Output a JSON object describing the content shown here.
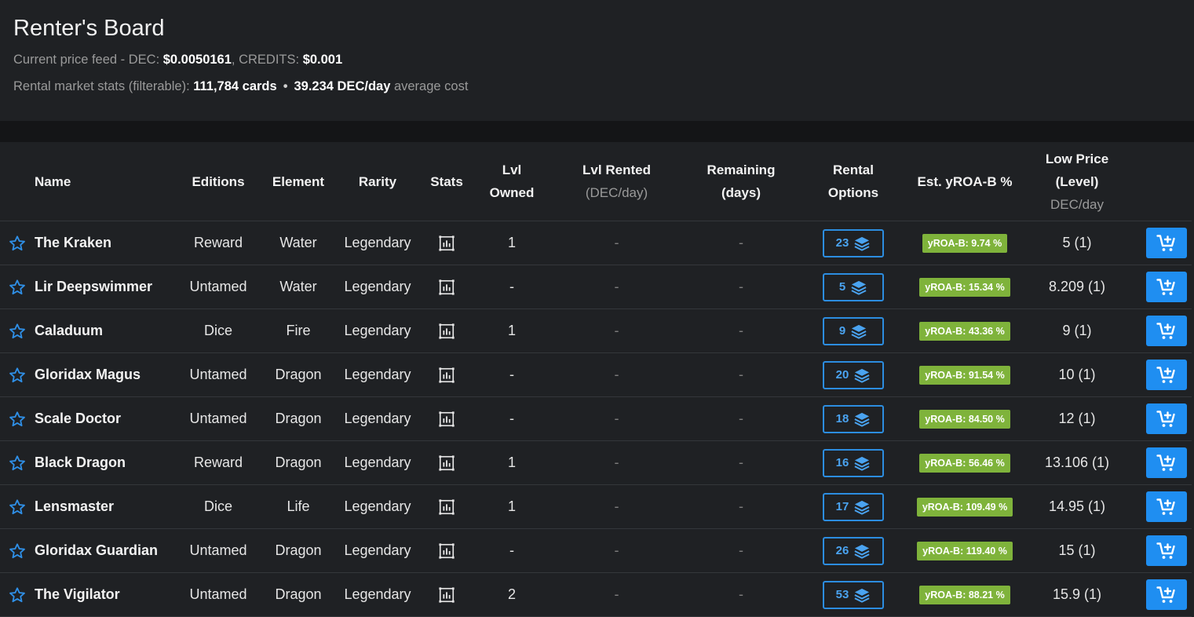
{
  "header": {
    "title": "Renter's Board",
    "price_feed_prefix": "Current price feed - DEC: ",
    "dec_price": "$0.0050161",
    "credits_prefix": ", CREDITS: ",
    "credits_price": "$0.001",
    "stats_prefix": "Rental market stats (filterable): ",
    "cards_count": "111,784 cards",
    "separator": "•",
    "avg_cost": "39.234 DEC/day",
    "avg_cost_suffix": " average cost"
  },
  "table": {
    "columns": {
      "name": "Name",
      "editions": "Editions",
      "element": "Element",
      "rarity": "Rarity",
      "stats": "Stats",
      "lvl_owned_1": "Lvl",
      "lvl_owned_2": "Owned",
      "lvl_rented_1": "Lvl Rented",
      "lvl_rented_2": "(DEC/day)",
      "remaining_1": "Remaining",
      "remaining_2": "(days)",
      "rental_1": "Rental",
      "rental_2": "Options",
      "yroa": "Est. yROA-B %",
      "low_price_1": "Low Price",
      "low_price_2": "(Level)",
      "low_price_3": "DEC/day"
    },
    "rows": [
      {
        "name": "The Kraken",
        "edition": "Reward",
        "element": "Water",
        "rarity": "Legendary",
        "lvl_owned": "1",
        "lvl_rented": "-",
        "remaining": "-",
        "options": "23",
        "yroa": "yROA-B: 9.74 %",
        "low_price": "5 (1)"
      },
      {
        "name": "Lir Deepswimmer",
        "edition": "Untamed",
        "element": "Water",
        "rarity": "Legendary",
        "lvl_owned": "-",
        "lvl_rented": "-",
        "remaining": "-",
        "options": "5",
        "yroa": "yROA-B: 15.34 %",
        "low_price": "8.209 (1)"
      },
      {
        "name": "Caladuum",
        "edition": "Dice",
        "element": "Fire",
        "rarity": "Legendary",
        "lvl_owned": "1",
        "lvl_rented": "-",
        "remaining": "-",
        "options": "9",
        "yroa": "yROA-B: 43.36 %",
        "low_price": "9 (1)"
      },
      {
        "name": "Gloridax Magus",
        "edition": "Untamed",
        "element": "Dragon",
        "rarity": "Legendary",
        "lvl_owned": "-",
        "lvl_rented": "-",
        "remaining": "-",
        "options": "20",
        "yroa": "yROA-B: 91.54 %",
        "low_price": "10 (1)"
      },
      {
        "name": "Scale Doctor",
        "edition": "Untamed",
        "element": "Dragon",
        "rarity": "Legendary",
        "lvl_owned": "-",
        "lvl_rented": "-",
        "remaining": "-",
        "options": "18",
        "yroa": "yROA-B: 84.50 %",
        "low_price": "12 (1)"
      },
      {
        "name": "Black Dragon",
        "edition": "Reward",
        "element": "Dragon",
        "rarity": "Legendary",
        "lvl_owned": "1",
        "lvl_rented": "-",
        "remaining": "-",
        "options": "16",
        "yroa": "yROA-B: 56.46 %",
        "low_price": "13.106 (1)"
      },
      {
        "name": "Lensmaster",
        "edition": "Dice",
        "element": "Life",
        "rarity": "Legendary",
        "lvl_owned": "1",
        "lvl_rented": "-",
        "remaining": "-",
        "options": "17",
        "yroa": "yROA-B: 109.49 %",
        "low_price": "14.95 (1)"
      },
      {
        "name": "Gloridax Guardian",
        "edition": "Untamed",
        "element": "Dragon",
        "rarity": "Legendary",
        "lvl_owned": "-",
        "lvl_rented": "-",
        "remaining": "-",
        "options": "26",
        "yroa": "yROA-B: 119.40 %",
        "low_price": "15 (1)"
      },
      {
        "name": "The Vigilator",
        "edition": "Untamed",
        "element": "Dragon",
        "rarity": "Legendary",
        "lvl_owned": "2",
        "lvl_rented": "-",
        "remaining": "-",
        "options": "53",
        "yroa": "yROA-B: 88.21 %",
        "low_price": "15.9 (1)"
      }
    ]
  },
  "icons": {
    "favorite": "star-outline-icon",
    "stats": "chart-icon",
    "rental_options": "layers-icon",
    "add_to_cart": "cart-plus-icon"
  },
  "colors": {
    "accent_blue": "#1f8ef1",
    "roa_green": "#7fb33b",
    "background": "#1f2124"
  }
}
